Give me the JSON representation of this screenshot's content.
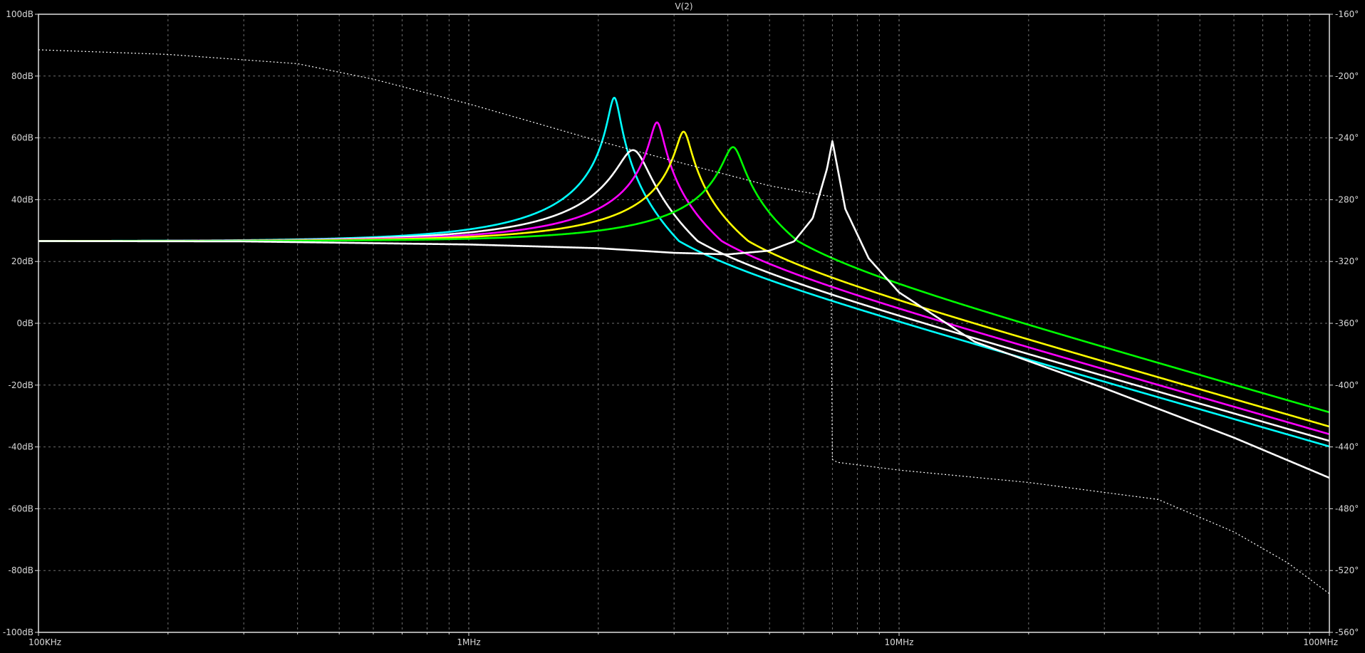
{
  "chart_data": {
    "type": "line",
    "title": "V(2)",
    "x_scale": "log",
    "xlim": [
      "100KHz",
      "100MHz"
    ],
    "x_tick_labels": [
      "100KHz",
      "1MHz",
      "10MHz",
      "100MHz"
    ],
    "y_left_ylim": [
      -100,
      100
    ],
    "y_left_tick_labels": [
      "100dB",
      "80dB",
      "60dB",
      "40dB",
      "20dB",
      "0dB",
      "-20dB",
      "-40dB",
      "-60dB",
      "-80dB",
      "-100dB"
    ],
    "y_right_ylim": [
      -560,
      -160
    ],
    "y_right_tick_labels": [
      "-160°",
      "-200°",
      "-240°",
      "-280°",
      "-320°",
      "-360°",
      "-400°",
      "-440°",
      "-480°",
      "-520°",
      "-560°"
    ],
    "grid": true,
    "background": "#000000",
    "series": [
      {
        "color": "#00ffff",
        "axis": "left",
        "style": "solid",
        "kind": "resonance",
        "f0_hz": 2180000,
        "peak_db": 73,
        "base_db": 26.6,
        "q": 18
      },
      {
        "color": "#ffffff",
        "axis": "left",
        "style": "solid",
        "kind": "resonance",
        "f0_hz": 2420000,
        "peak_db": 56,
        "base_db": 26.6,
        "q": 7
      },
      {
        "color": "#ff00ff",
        "axis": "left",
        "style": "solid",
        "kind": "resonance",
        "f0_hz": 2740000,
        "peak_db": 65,
        "base_db": 26.6,
        "q": 16
      },
      {
        "color": "#ffff00",
        "axis": "left",
        "style": "solid",
        "kind": "resonance",
        "f0_hz": 3160000,
        "peak_db": 62,
        "base_db": 26.6,
        "q": 15
      },
      {
        "color": "#00ff00",
        "axis": "left",
        "style": "solid",
        "kind": "resonance",
        "f0_hz": 4120000,
        "peak_db": 57,
        "base_db": 26.6,
        "q": 11
      },
      {
        "color": "#ffffff",
        "axis": "left",
        "style": "solid",
        "kind": "points",
        "x_hz": [
          100000,
          300000,
          1000000,
          2000000,
          3000000,
          4000000,
          5000000,
          5700000,
          6300000,
          6800000,
          7000000,
          7200000,
          7500000,
          8500000,
          10000000,
          15000000,
          30000000,
          60000000,
          100000000
        ],
        "y_db": [
          26.6,
          26.5,
          25.5,
          24.3,
          22.8,
          22.3,
          23.5,
          26.5,
          34,
          50,
          59,
          50,
          37,
          21,
          10,
          -6,
          -21,
          -37,
          -50
        ]
      },
      {
        "color": "#ffffff",
        "axis": "right",
        "style": "dotted",
        "kind": "points",
        "x_hz": [
          100000,
          200000,
          400000,
          600000,
          1000000,
          1500000,
          2000000,
          3000000,
          4000000,
          5000000,
          6000000,
          6950000,
          6980000,
          7200000,
          10000000,
          20000000,
          40000000,
          60000000,
          80000000,
          100000000
        ],
        "y_deg": [
          -183,
          -186,
          -192,
          -202,
          -218,
          -232,
          -242,
          -255,
          -264,
          -271,
          -275,
          -278,
          -448,
          -450,
          -455,
          -463,
          -474,
          -495,
          -515,
          -535
        ]
      }
    ]
  }
}
